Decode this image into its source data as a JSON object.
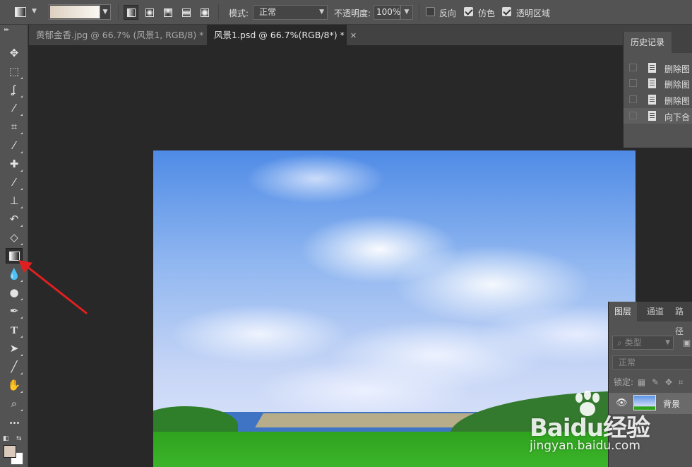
{
  "options_bar": {
    "mode_label": "模式:",
    "mode_value": "正常",
    "opacity_label": "不透明度:",
    "opacity_value": "100%",
    "reverse_label": "反向",
    "reverse_checked": false,
    "dither_label": "仿色",
    "dither_checked": true,
    "transparency_label": "透明区域",
    "transparency_checked": true,
    "gradient_colors": [
      "#ddd0c0",
      "#faf7f2"
    ]
  },
  "doc_tabs": [
    {
      "label": "黄郁金香.jpg @ 66.7% (风景1, RGB/8) *",
      "active": false
    },
    {
      "label": "风景1.psd @ 66.7%(RGB/8*) *",
      "active": true
    }
  ],
  "toolbar": {
    "tools": [
      {
        "name": "move-tool",
        "glyph": "✥"
      },
      {
        "name": "marquee-tool",
        "glyph": "⬚"
      },
      {
        "name": "lasso-tool",
        "glyph": "ʆ"
      },
      {
        "name": "magic-wand-tool",
        "glyph": "⁄"
      },
      {
        "name": "crop-tool",
        "glyph": "⌗"
      },
      {
        "name": "eyedropper-tool",
        "glyph": "⁄"
      },
      {
        "name": "healing-brush-tool",
        "glyph": "✚"
      },
      {
        "name": "brush-tool",
        "glyph": "⁄"
      },
      {
        "name": "clone-stamp-tool",
        "glyph": "⊥"
      },
      {
        "name": "history-brush-tool",
        "glyph": "↶"
      },
      {
        "name": "eraser-tool",
        "glyph": "◇"
      },
      {
        "name": "gradient-tool",
        "glyph": ""
      },
      {
        "name": "blur-tool",
        "glyph": "💧"
      },
      {
        "name": "dodge-tool",
        "glyph": "●"
      },
      {
        "name": "pen-tool",
        "glyph": "✒"
      },
      {
        "name": "type-tool",
        "glyph": "T"
      },
      {
        "name": "path-selection-tool",
        "glyph": "➤"
      },
      {
        "name": "line-tool",
        "glyph": "╱"
      },
      {
        "name": "hand-tool",
        "glyph": "✋"
      },
      {
        "name": "zoom-tool",
        "glyph": "⌕"
      },
      {
        "name": "more-tools",
        "glyph": "•••"
      }
    ],
    "selected_tool": "gradient-tool",
    "foreground_color": "#d9cabb",
    "background_color": "#ffffff"
  },
  "history_panel": {
    "title": "历史记录",
    "items": [
      "删除图",
      "删除图",
      "删除图",
      "向下合"
    ]
  },
  "layers_panel": {
    "tabs": [
      "图层",
      "通道",
      "路径"
    ],
    "filter_placeholder": "类型",
    "blend_mode": "正常",
    "lock_label": "锁定:",
    "layers": [
      {
        "name": "背景",
        "visible": true
      }
    ]
  },
  "watermark": {
    "brand": "Baidu经验",
    "url": "jingyan.baidu.com"
  },
  "colors": {
    "annotation_arrow": "#e02020"
  }
}
